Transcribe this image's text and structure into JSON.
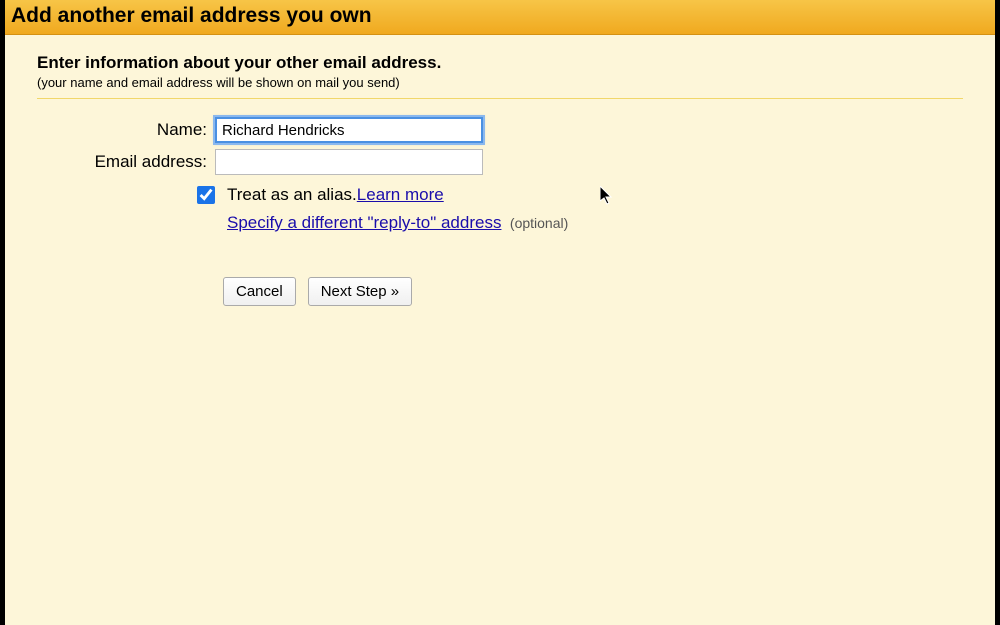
{
  "title": "Add another email address you own",
  "instructions": {
    "heading": "Enter information about your other email address.",
    "sub": "(your name and email address will be shown on mail you send)"
  },
  "form": {
    "name_label": "Name:",
    "name_value": "Richard Hendricks",
    "email_label": "Email address:",
    "email_value": ""
  },
  "alias": {
    "checked": true,
    "text": "Treat as an alias. ",
    "learn_more": "Learn more"
  },
  "replyto": {
    "link": "Specify a different \"reply-to\" address",
    "optional": "(optional)"
  },
  "buttons": {
    "cancel": "Cancel",
    "next": "Next Step »"
  }
}
